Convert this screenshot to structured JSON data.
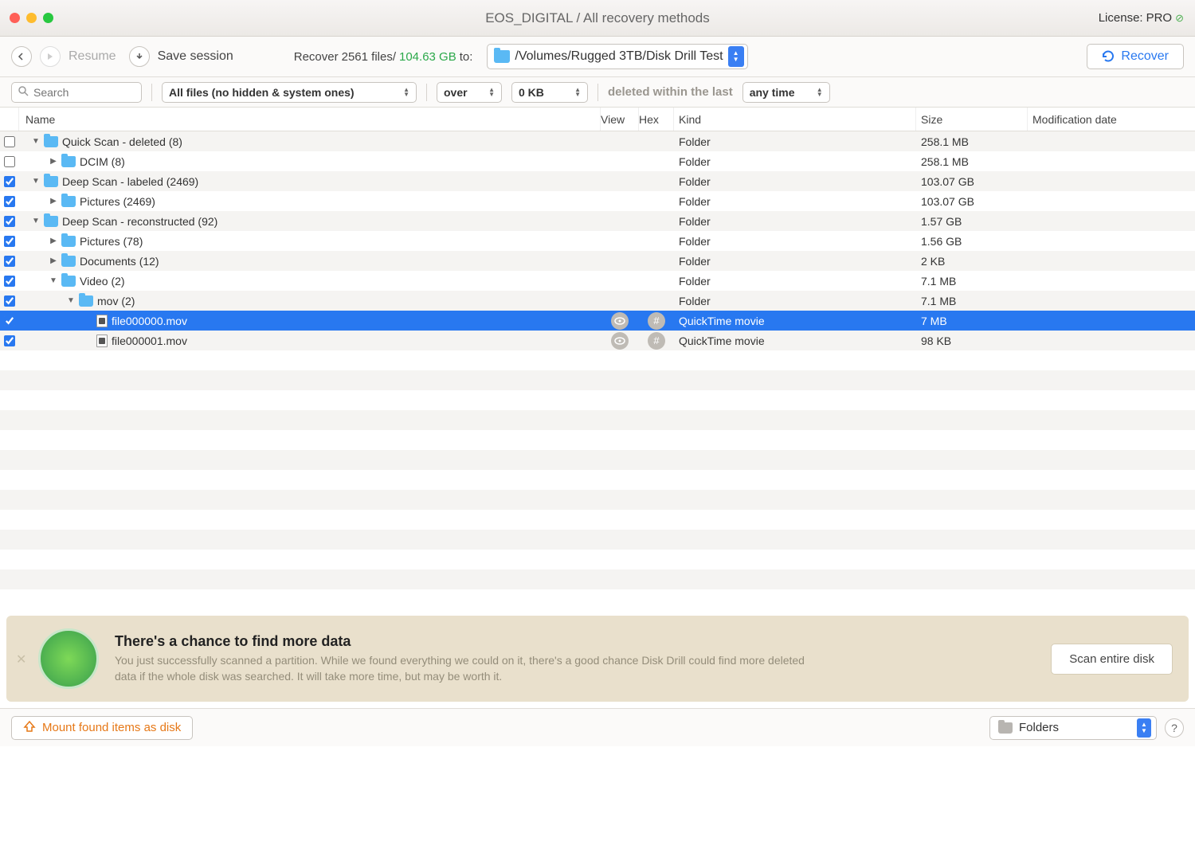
{
  "title": "EOS_DIGITAL / All recovery methods",
  "license": {
    "label": "License:",
    "value": "PRO"
  },
  "toolbar": {
    "resume": "Resume",
    "save_session": "Save session",
    "recover_prefix": "Recover",
    "recover_count": "2561 files/",
    "recover_size": "104.63 GB",
    "to_label": "to:",
    "dest_path": "/Volumes/Rugged 3TB/Disk Drill Test",
    "recover_button": "Recover"
  },
  "filters": {
    "search_placeholder": "Search",
    "files_filter": "All files (no hidden & system ones)",
    "over": "over",
    "size_threshold": "0 KB",
    "deleted_label": "deleted within the last",
    "time_filter": "any time"
  },
  "columns": {
    "name": "Name",
    "view": "View",
    "hex": "Hex",
    "kind": "Kind",
    "size": "Size",
    "mod": "Modification date"
  },
  "rows": [
    {
      "indent": 0,
      "checked": false,
      "expanded": true,
      "icon": "folder-scan",
      "name": "Quick Scan - deleted (8)",
      "kind": "Folder",
      "size": "258.1 MB"
    },
    {
      "indent": 1,
      "checked": false,
      "expanded": false,
      "icon": "folder",
      "name": "DCIM (8)",
      "kind": "Folder",
      "size": "258.1 MB"
    },
    {
      "indent": 0,
      "checked": true,
      "expanded": true,
      "icon": "folder-scan",
      "name": "Deep Scan - labeled (2469)",
      "kind": "Folder",
      "size": "103.07 GB"
    },
    {
      "indent": 1,
      "checked": true,
      "expanded": false,
      "icon": "folder",
      "name": "Pictures (2469)",
      "kind": "Folder",
      "size": "103.07 GB"
    },
    {
      "indent": 0,
      "checked": true,
      "expanded": true,
      "icon": "folder-scan",
      "name": "Deep Scan - reconstructed (92)",
      "kind": "Folder",
      "size": "1.57 GB"
    },
    {
      "indent": 1,
      "checked": true,
      "expanded": false,
      "icon": "folder",
      "name": "Pictures (78)",
      "kind": "Folder",
      "size": "1.56 GB"
    },
    {
      "indent": 1,
      "checked": true,
      "expanded": false,
      "icon": "folder",
      "name": "Documents (12)",
      "kind": "Folder",
      "size": "2 KB"
    },
    {
      "indent": 1,
      "checked": true,
      "expanded": true,
      "icon": "folder",
      "name": "Video (2)",
      "kind": "Folder",
      "size": "7.1 MB"
    },
    {
      "indent": 2,
      "checked": true,
      "expanded": true,
      "icon": "folder",
      "name": "mov (2)",
      "kind": "Folder",
      "size": "7.1 MB"
    },
    {
      "indent": 3,
      "checked": true,
      "icon": "file",
      "name": "file000000.mov",
      "kind": "QuickTime movie",
      "size": "7 MB",
      "selected": true,
      "viewhex": true
    },
    {
      "indent": 3,
      "checked": true,
      "icon": "file",
      "name": "file000001.mov",
      "kind": "QuickTime movie",
      "size": "98 KB",
      "viewhex": true
    }
  ],
  "banner": {
    "title": "There's a chance to find more data",
    "desc": "You just successfully scanned a partition. While we found everything we could on it, there's a good chance Disk Drill could find more deleted data if the whole disk was searched. It will take more time, but may be worth it.",
    "button": "Scan entire disk"
  },
  "footer": {
    "mount": "Mount found items as disk",
    "view_mode": "Folders"
  }
}
